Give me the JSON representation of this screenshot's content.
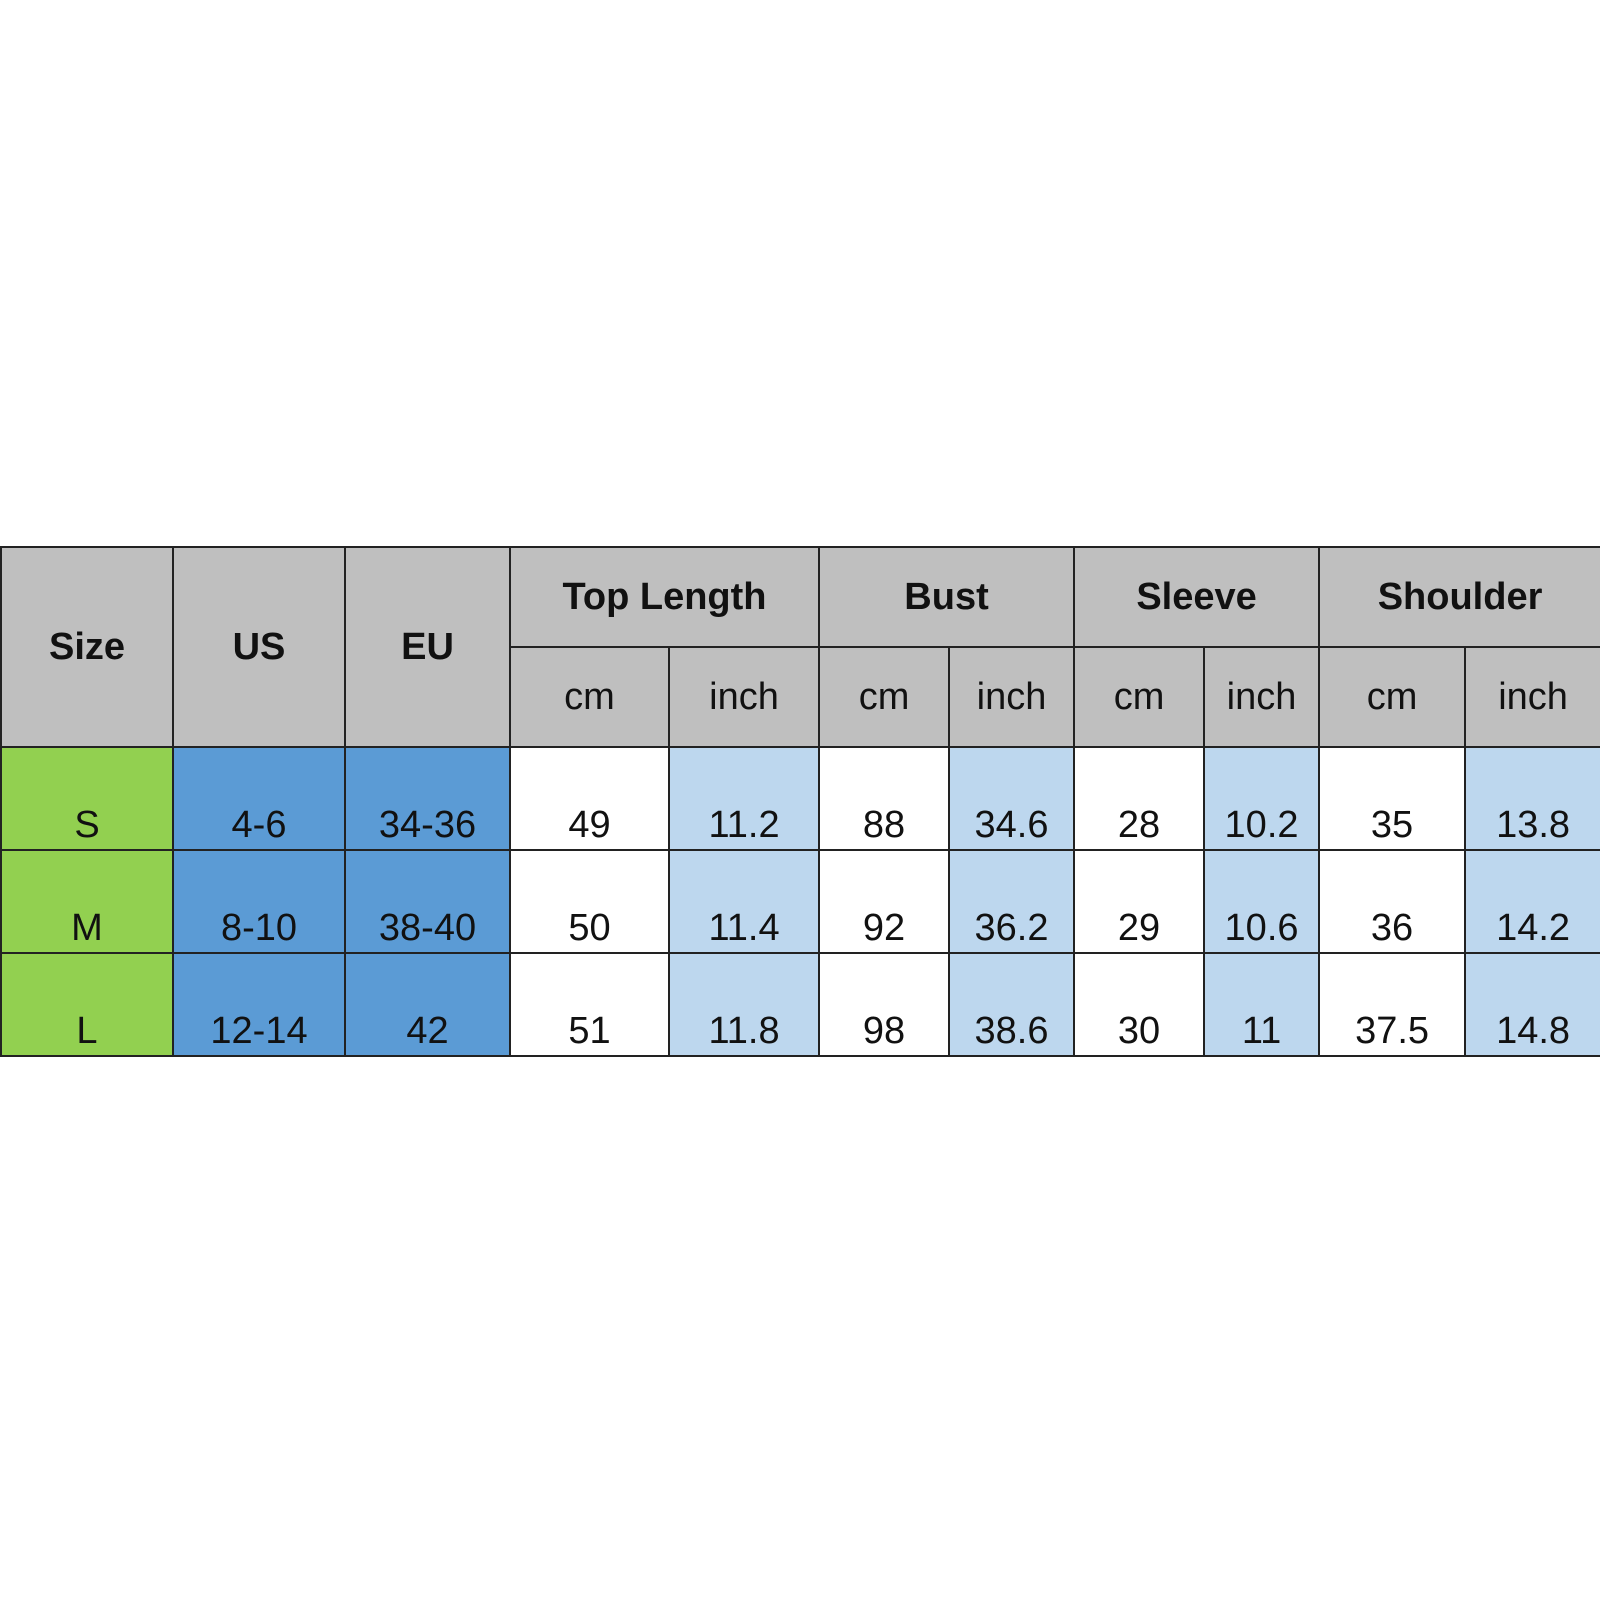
{
  "table": {
    "headers": {
      "size": "Size",
      "us": "US",
      "eu": "EU",
      "groups": [
        "Top Length",
        "Bust",
        "Sleeve",
        "Shoulder"
      ],
      "units": [
        "cm",
        "inch",
        "cm",
        "inch",
        "cm",
        "inch",
        "cm",
        "inch"
      ]
    },
    "rows": [
      {
        "size": "S",
        "us": "4-6",
        "eu": "34-36",
        "values": [
          "49",
          "11.2",
          "88",
          "34.6",
          "28",
          "10.2",
          "35",
          "13.8"
        ]
      },
      {
        "size": "M",
        "us": "8-10",
        "eu": "38-40",
        "values": [
          "50",
          "11.4",
          "92",
          "36.2",
          "29",
          "10.6",
          "36",
          "14.2"
        ]
      },
      {
        "size": "L",
        "us": "12-14",
        "eu": "42",
        "values": [
          "51",
          "11.8",
          "98",
          "38.6",
          "30",
          "11",
          "37.5",
          "14.8"
        ]
      }
    ]
  },
  "colors": {
    "header_bg": "#bfbfbf",
    "size_col": "#92d050",
    "region_cols": "#5b9bd5",
    "inch_cols": "#bdd7ee",
    "cm_cols": "#ffffff"
  }
}
